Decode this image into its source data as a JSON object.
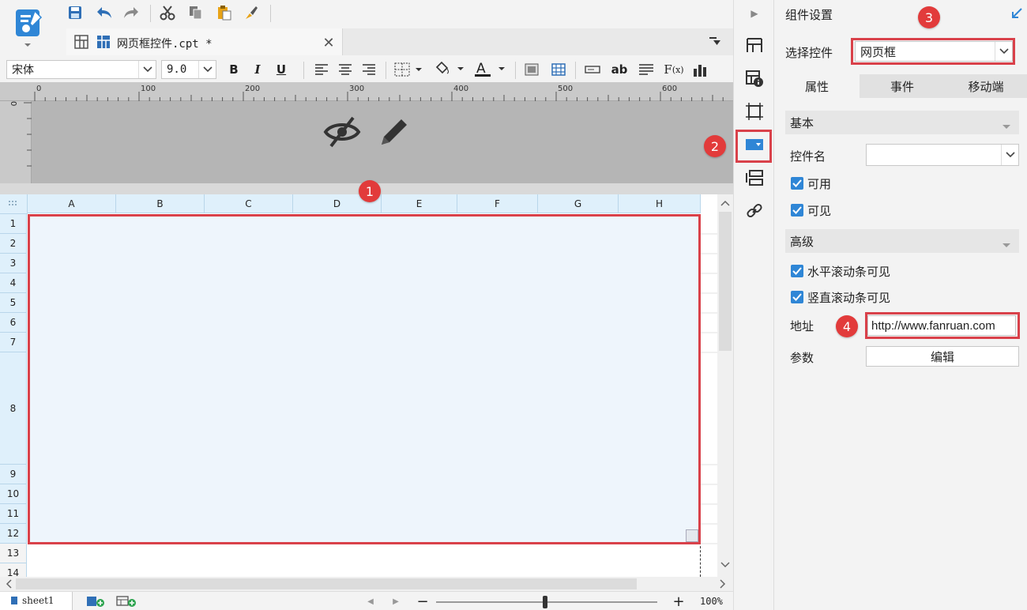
{
  "document_tab": {
    "filename": "网页框控件.cpt *"
  },
  "format_bar": {
    "font_name": "宋体",
    "font_size": "9.0"
  },
  "ruler": {
    "ticks": [
      "0",
      "100",
      "200",
      "300",
      "400",
      "500",
      "600"
    ],
    "vertical_tick": "0"
  },
  "grid": {
    "columns": [
      "A",
      "B",
      "C",
      "D",
      "E",
      "F",
      "G",
      "H"
    ],
    "rows": [
      "1",
      "2",
      "3",
      "4",
      "5",
      "6",
      "7",
      "8",
      "9",
      "10",
      "11",
      "12",
      "13",
      "14"
    ]
  },
  "status_bar": {
    "sheet_name": "sheet1",
    "zoom": "100%"
  },
  "panel": {
    "title": "组件设置",
    "select_label": "选择控件",
    "select_value": "网页框",
    "tabs": [
      "属性",
      "事件",
      "移动端"
    ],
    "section_basic": "基本",
    "name_label": "控件名",
    "name_value": "",
    "enabled_label": "可用",
    "visible_label": "可见",
    "section_advanced": "高级",
    "hscroll_label": "水平滚动条可见",
    "vscroll_label": "竖直滚动条可见",
    "address_label": "地址",
    "address_value": "http://www.fanruan.com",
    "params_label": "参数",
    "edit_label": "编辑"
  },
  "callouts": [
    "1",
    "2",
    "3",
    "4"
  ],
  "colors": {
    "accent": "#2f86d6",
    "highlight_red": "#d9414a",
    "callout_red": "#e23b3b",
    "cell_selection": "#eef5fc"
  },
  "icons": {
    "header_overlay": [
      "eye-hidden-icon",
      "pencil-icon"
    ],
    "side_strip": [
      "collapse-arrow-icon",
      "layout-icon",
      "cell-info-icon",
      "frame-icon",
      "widget-icon",
      "form-icon",
      "link-icon"
    ]
  }
}
